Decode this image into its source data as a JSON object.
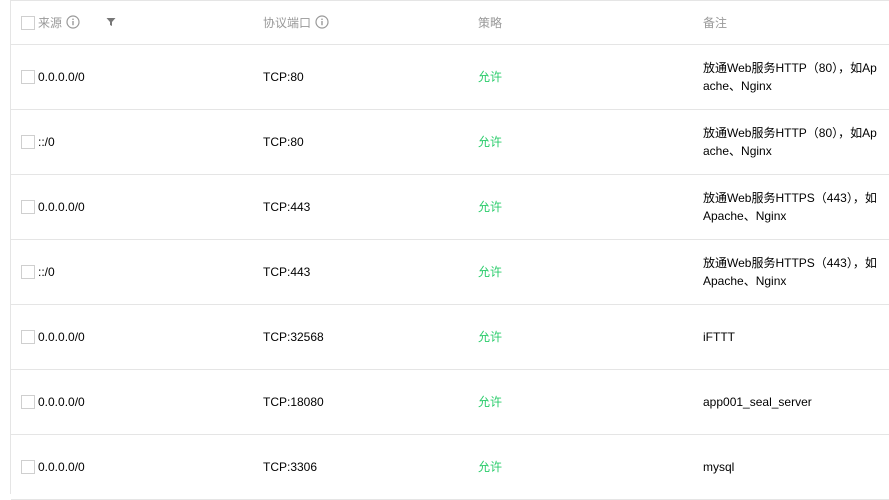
{
  "table": {
    "headers": {
      "source": "来源",
      "protocol_port": "协议端口",
      "policy": "策略",
      "note": "备注"
    },
    "rows": [
      {
        "source": "0.0.0.0/0",
        "protocol_port": "TCP:80",
        "policy": "允许",
        "note": "放通Web服务HTTP（80），如Apache、Nginx"
      },
      {
        "source": "::/0",
        "protocol_port": "TCP:80",
        "policy": "允许",
        "note": "放通Web服务HTTP（80），如Apache、Nginx"
      },
      {
        "source": "0.0.0.0/0",
        "protocol_port": "TCP:443",
        "policy": "允许",
        "note": "放通Web服务HTTPS（443），如Apache、Nginx"
      },
      {
        "source": "::/0",
        "protocol_port": "TCP:443",
        "policy": "允许",
        "note": "放通Web服务HTTPS（443），如Apache、Nginx"
      },
      {
        "source": "0.0.0.0/0",
        "protocol_port": "TCP:32568",
        "policy": "允许",
        "note": "iFTTT"
      },
      {
        "source": "0.0.0.0/0",
        "protocol_port": "TCP:18080",
        "policy": "允许",
        "note": "app001_seal_server"
      },
      {
        "source": "0.0.0.0/0",
        "protocol_port": "TCP:3306",
        "policy": "允许",
        "note": "mysql"
      }
    ]
  },
  "colors": {
    "allow": "#29cc6a",
    "header_text": "#999999",
    "border": "#e5e5e5"
  },
  "icons": {
    "source_info": "info-icon",
    "source_filter": "filter-icon",
    "protocol_info": "info-icon"
  }
}
